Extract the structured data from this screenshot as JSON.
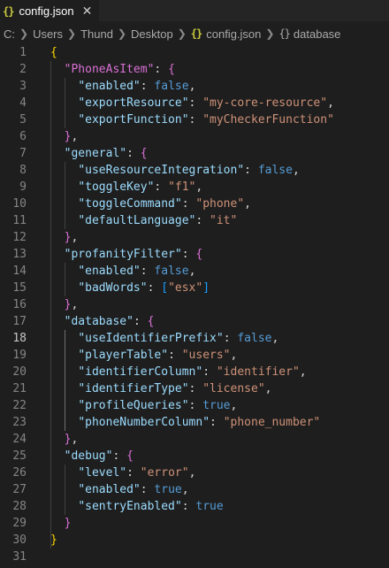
{
  "tab": {
    "icon": "{}",
    "label": "config.json",
    "close": "✕"
  },
  "breadcrumb": {
    "parts": [
      "C:",
      "Users",
      "Thund",
      "Desktop"
    ],
    "file_icon": "{}",
    "file": "config.json",
    "symbol_icon": "{}",
    "symbol": "database"
  },
  "editor": {
    "active_line": 18,
    "lines": [
      [
        [
          "b1",
          "{"
        ]
      ],
      [
        [
          "i",
          "  "
        ],
        [
          "b2",
          "\"PhoneAsItem\""
        ],
        [
          "p",
          ": "
        ],
        [
          "b2",
          "{"
        ]
      ],
      [
        [
          "i",
          "    "
        ],
        [
          "k",
          "\"enabled\""
        ],
        [
          "p",
          ": "
        ],
        [
          "v",
          "false"
        ],
        [
          "p",
          ","
        ]
      ],
      [
        [
          "i",
          "    "
        ],
        [
          "k",
          "\"exportResource\""
        ],
        [
          "p",
          ": "
        ],
        [
          "s",
          "\"my-core-resource\""
        ],
        [
          "p",
          ","
        ]
      ],
      [
        [
          "i",
          "    "
        ],
        [
          "k",
          "\"exportFunction\""
        ],
        [
          "p",
          ": "
        ],
        [
          "s",
          "\"myCheckerFunction\""
        ]
      ],
      [
        [
          "i",
          "  "
        ],
        [
          "b2",
          "}"
        ],
        [
          "p",
          ","
        ]
      ],
      [
        [
          "i",
          "  "
        ],
        [
          "k",
          "\"general\""
        ],
        [
          "p",
          ": "
        ],
        [
          "b2",
          "{"
        ]
      ],
      [
        [
          "i",
          "    "
        ],
        [
          "k",
          "\"useResourceIntegration\""
        ],
        [
          "p",
          ": "
        ],
        [
          "v",
          "false"
        ],
        [
          "p",
          ","
        ]
      ],
      [
        [
          "i",
          "    "
        ],
        [
          "k",
          "\"toggleKey\""
        ],
        [
          "p",
          ": "
        ],
        [
          "s",
          "\"f1\""
        ],
        [
          "p",
          ","
        ]
      ],
      [
        [
          "i",
          "    "
        ],
        [
          "k",
          "\"toggleCommand\""
        ],
        [
          "p",
          ": "
        ],
        [
          "s",
          "\"phone\""
        ],
        [
          "p",
          ","
        ]
      ],
      [
        [
          "i",
          "    "
        ],
        [
          "k",
          "\"defaultLanguage\""
        ],
        [
          "p",
          ": "
        ],
        [
          "s",
          "\"it\""
        ]
      ],
      [
        [
          "i",
          "  "
        ],
        [
          "b2",
          "}"
        ],
        [
          "p",
          ","
        ]
      ],
      [
        [
          "i",
          "  "
        ],
        [
          "k",
          "\"profanityFilter\""
        ],
        [
          "p",
          ": "
        ],
        [
          "b2",
          "{"
        ]
      ],
      [
        [
          "i",
          "    "
        ],
        [
          "k",
          "\"enabled\""
        ],
        [
          "p",
          ": "
        ],
        [
          "v",
          "false"
        ],
        [
          "p",
          ","
        ]
      ],
      [
        [
          "i",
          "    "
        ],
        [
          "k",
          "\"badWords\""
        ],
        [
          "p",
          ": "
        ],
        [
          "b3",
          "["
        ],
        [
          "s",
          "\"esx\""
        ],
        [
          "b3",
          "]"
        ]
      ],
      [
        [
          "i",
          "  "
        ],
        [
          "b2",
          "}"
        ],
        [
          "p",
          ","
        ]
      ],
      [
        [
          "i",
          "  "
        ],
        [
          "k",
          "\"database\""
        ],
        [
          "p",
          ": "
        ],
        [
          "b2",
          "{"
        ]
      ],
      [
        [
          "i",
          "    "
        ],
        [
          "k",
          "\"useIdentifierPrefix\""
        ],
        [
          "p",
          ": "
        ],
        [
          "v",
          "false"
        ],
        [
          "p",
          ","
        ]
      ],
      [
        [
          "i",
          "    "
        ],
        [
          "k",
          "\"playerTable\""
        ],
        [
          "p",
          ": "
        ],
        [
          "s",
          "\"users\""
        ],
        [
          "p",
          ","
        ]
      ],
      [
        [
          "i",
          "    "
        ],
        [
          "k",
          "\"identifierColumn\""
        ],
        [
          "p",
          ": "
        ],
        [
          "s",
          "\"identifier\""
        ],
        [
          "p",
          ","
        ]
      ],
      [
        [
          "i",
          "    "
        ],
        [
          "k",
          "\"identifierType\""
        ],
        [
          "p",
          ": "
        ],
        [
          "s",
          "\"license\""
        ],
        [
          "p",
          ","
        ]
      ],
      [
        [
          "i",
          "    "
        ],
        [
          "k",
          "\"profileQueries\""
        ],
        [
          "p",
          ": "
        ],
        [
          "v",
          "true"
        ],
        [
          "p",
          ","
        ]
      ],
      [
        [
          "i",
          "    "
        ],
        [
          "k",
          "\"phoneNumberColumn\""
        ],
        [
          "p",
          ": "
        ],
        [
          "s",
          "\"phone_number\""
        ]
      ],
      [
        [
          "i",
          "  "
        ],
        [
          "b2",
          "}"
        ],
        [
          "p",
          ","
        ]
      ],
      [
        [
          "i",
          "  "
        ],
        [
          "k",
          "\"debug\""
        ],
        [
          "p",
          ": "
        ],
        [
          "b2",
          "{"
        ]
      ],
      [
        [
          "i",
          "    "
        ],
        [
          "k",
          "\"level\""
        ],
        [
          "p",
          ": "
        ],
        [
          "s",
          "\"error\""
        ],
        [
          "p",
          ","
        ]
      ],
      [
        [
          "i",
          "    "
        ],
        [
          "k",
          "\"enabled\""
        ],
        [
          "p",
          ": "
        ],
        [
          "v",
          "true"
        ],
        [
          "p",
          ","
        ]
      ],
      [
        [
          "i",
          "    "
        ],
        [
          "k",
          "\"sentryEnabled\""
        ],
        [
          "p",
          ": "
        ],
        [
          "v",
          "true"
        ]
      ],
      [
        [
          "i",
          "  "
        ],
        [
          "b2",
          "}"
        ]
      ],
      [
        [
          "b1",
          "}"
        ]
      ],
      []
    ]
  }
}
